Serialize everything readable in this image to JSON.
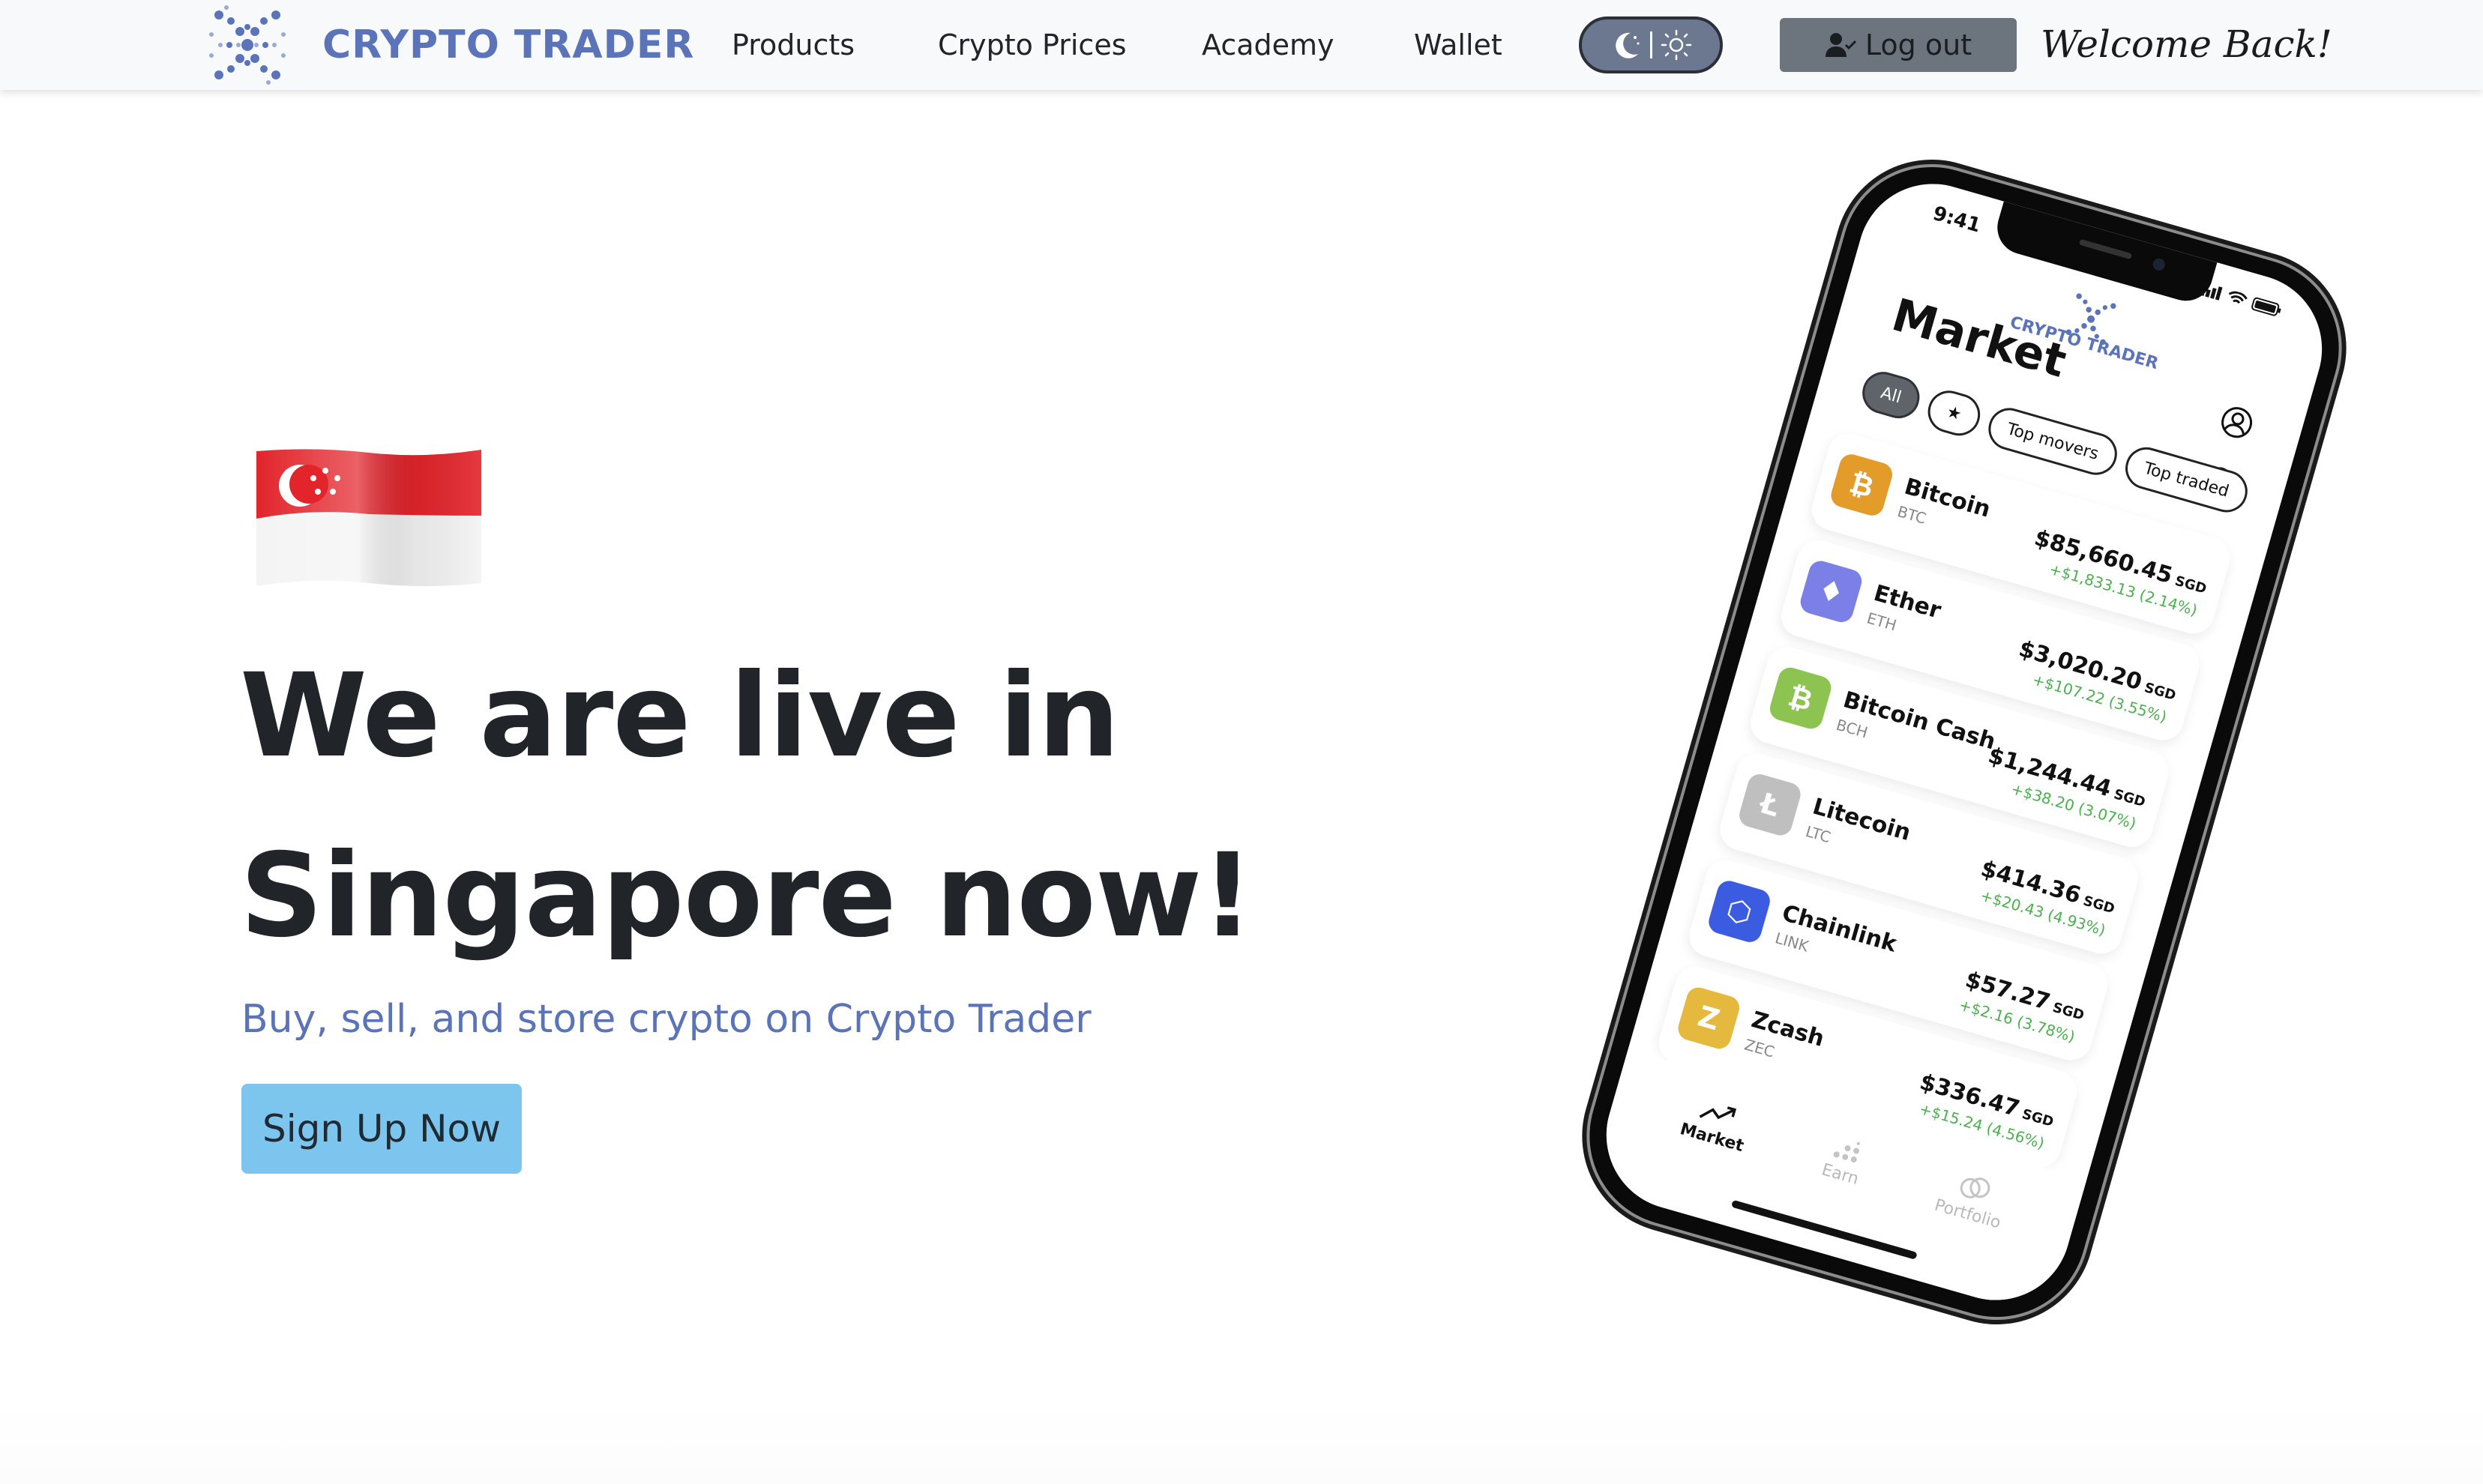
{
  "navbar": {
    "brand": "CRYPTO TRADER",
    "links": [
      "Products",
      "Crypto Prices",
      "Academy",
      "Wallet"
    ],
    "theme_toggle": {
      "icons": [
        "moon-icon",
        "sun-icon"
      ]
    },
    "logout_label": "Log out",
    "welcome_text": "Welcome Back!"
  },
  "hero": {
    "flag": "singapore-flag",
    "title_line1": "We are live in",
    "title_line2": "Singapore now!",
    "subtitle": "Buy, sell, and store crypto on Crypto Trader",
    "cta_label": "Sign Up Now"
  },
  "colors": {
    "brand": "#5b73b8",
    "cta": "#7cc5ee",
    "logout": "#6c757d",
    "positive": "#4caf50"
  },
  "phone": {
    "status_time": "9:41",
    "app_brand": "CRYPTO TRADER",
    "screen_title": "Market",
    "filter_chips": [
      {
        "label": "All",
        "active": true
      },
      {
        "label": "★",
        "active": false
      },
      {
        "label": "Top movers",
        "active": false
      },
      {
        "label": "Top traded",
        "active": false
      }
    ],
    "coins": [
      {
        "name": "Bitcoin",
        "symbol": "BTC",
        "price": "$85,660.45",
        "currency": "SGD",
        "change": "+$1,833.13 (2.14%)",
        "color": "#e39b2a",
        "glyph": "₿"
      },
      {
        "name": "Ether",
        "symbol": "ETH",
        "price": "$3,020.20",
        "currency": "SGD",
        "change": "+$107.22 (3.55%)",
        "color": "#7b80e6",
        "glyph": "♦"
      },
      {
        "name": "Bitcoin Cash",
        "symbol": "BCH",
        "price": "$1,244.44",
        "currency": "SGD",
        "change": "+$38.20 (3.07%)",
        "color": "#8dc351",
        "glyph": "₿"
      },
      {
        "name": "Litecoin",
        "symbol": "LTC",
        "price": "$414.36",
        "currency": "SGD",
        "change": "+$20.43 (4.93%)",
        "color": "#bfbfbf",
        "glyph": "Ł"
      },
      {
        "name": "Chainlink",
        "symbol": "LINK",
        "price": "$57.27",
        "currency": "SGD",
        "change": "+$2.16 (3.78%)",
        "color": "#3b5be0",
        "glyph": "⬡"
      },
      {
        "name": "Zcash",
        "symbol": "ZEC",
        "price": "$336.47",
        "currency": "SGD",
        "change": "+$15.24 (4.56%)",
        "color": "#e5b83e",
        "glyph": "Z"
      }
    ],
    "tabs": [
      {
        "label": "Market",
        "icon": "trend-icon",
        "active": true
      },
      {
        "label": "Earn",
        "icon": "dots-icon",
        "active": false
      },
      {
        "label": "Portfolio",
        "icon": "rings-icon",
        "active": false
      }
    ]
  }
}
